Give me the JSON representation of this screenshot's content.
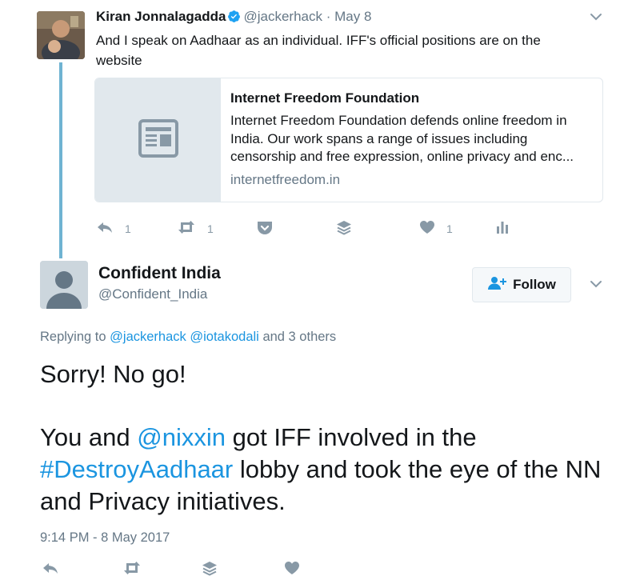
{
  "tweet1": {
    "author_name": "Kiran Jonnalagadda",
    "handle": "@jackerhack",
    "separator": "·",
    "date": "May 8",
    "text": "And I speak on Aadhaar as an individual. IFF's official positions are on the website",
    "card": {
      "title": "Internet Freedom Foundation",
      "description": "Internet Freedom Foundation defends online freedom in India. Our work spans a range of issues including censorship and free expression, online privacy and enc...",
      "url": "internetfreedom.in"
    },
    "actions": {
      "reply_count": "1",
      "retweet_count": "1",
      "like_count": "1"
    }
  },
  "tweet2": {
    "author_name": "Confident India",
    "handle": "@Confident_India",
    "follow_label": "Follow",
    "replying_prefix": "Replying to",
    "replying_user1": "@jackerhack",
    "replying_user2": "@iotakodali",
    "replying_suffix": "and 3 others",
    "text_line1": "Sorry! No go!",
    "text_part1": "You and ",
    "text_mention": "@nixxin",
    "text_part2": " got IFF involved in the ",
    "text_hashtag": "#DestroyAadhaar",
    "text_part3": " lobby and took the eye of the NN and Privacy initiatives.",
    "timestamp": "9:14 PM - 8 May 2017"
  },
  "icons": [
    "reply-icon",
    "retweet-icon",
    "pocket-icon",
    "buffer-icon",
    "heart-icon",
    "analytics-icon",
    "chevron-down-icon",
    "verified-icon",
    "follow-person-icon",
    "article-icon"
  ],
  "colors": {
    "link": "#1b95e0",
    "muted": "#657786",
    "icon": "#8899a6",
    "thread_line": "#6fb3d2",
    "verified": "#1da1f2"
  }
}
